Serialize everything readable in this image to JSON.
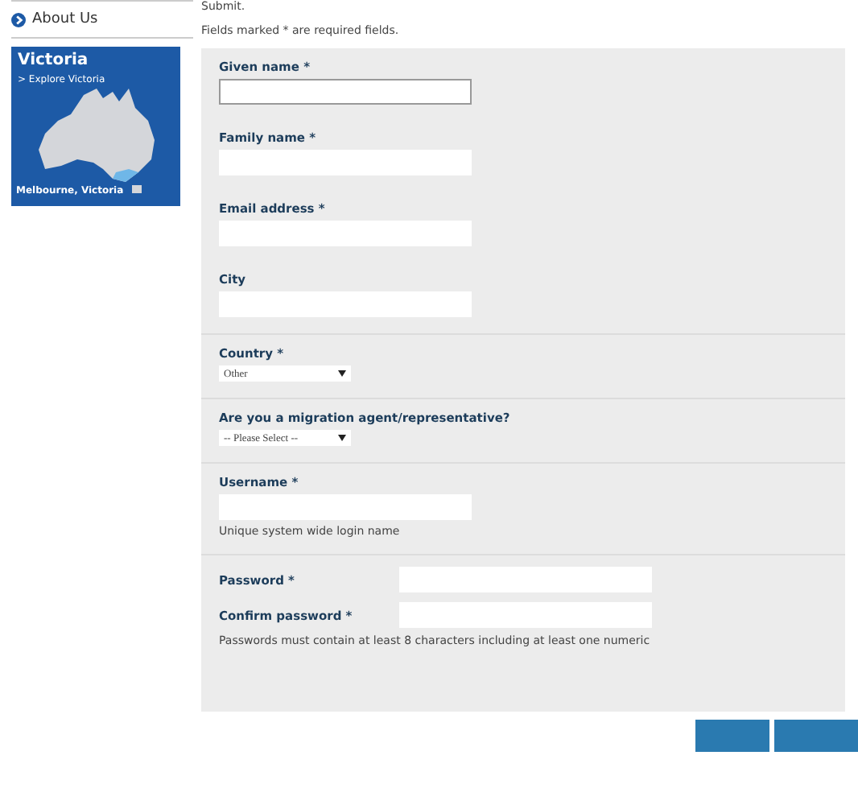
{
  "sidebar": {
    "nav_item": "About Us",
    "promo": {
      "title": "Victoria",
      "link": "> Explore Victoria",
      "caption": "Melbourne, Victoria"
    }
  },
  "intro": "Submit.",
  "required_note": "Fields marked * are required fields.",
  "sections": [
    {
      "fields": [
        {
          "kind": "text",
          "label": "Given name *",
          "focused": true
        },
        {
          "kind": "text",
          "label": "Family name *",
          "focused": false
        },
        {
          "kind": "text",
          "label": "Email address *",
          "focused": false
        },
        {
          "kind": "text",
          "label": "City",
          "focused": false
        }
      ]
    },
    {
      "fields": [
        {
          "kind": "select",
          "label": "Country *",
          "value": "Other"
        }
      ]
    },
    {
      "fields": [
        {
          "kind": "select",
          "label": "Are you a migration agent/representative?",
          "value": "-- Please Select --"
        }
      ]
    },
    {
      "fields": [
        {
          "kind": "text",
          "label": "Username *",
          "hint": "Unique system wide login name",
          "focused": false
        }
      ]
    },
    {
      "fields": [
        {
          "kind": "inline",
          "label": "Password *"
        },
        {
          "kind": "inline",
          "label": "Confirm password *",
          "hint": "Passwords must contain at least 8 characters including at least one numeric"
        }
      ]
    }
  ]
}
